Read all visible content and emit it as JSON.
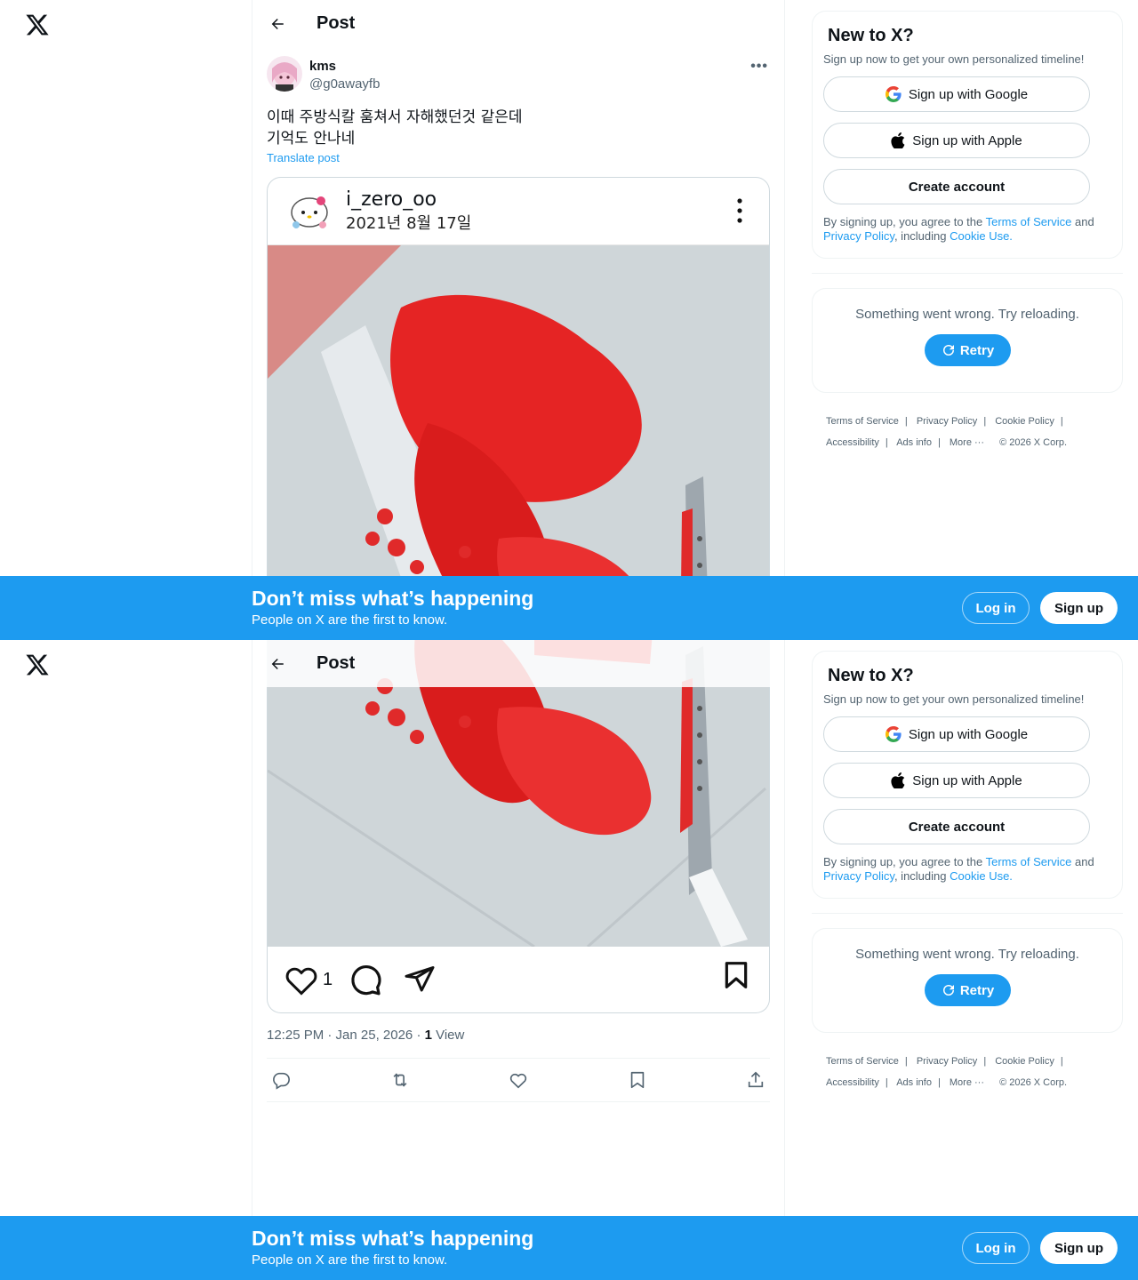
{
  "header": {
    "title": "Post"
  },
  "post": {
    "author_name": "kms",
    "author_handle": "@g0awayfb",
    "text": "이때 주방식칼 훔쳐서 자해했던것 같은데\n기억도 안나네",
    "translate": "Translate post",
    "timestamp": "12:25 PM · Jan 25, 2026 · ",
    "views_count": "1",
    "views_label": " View"
  },
  "embedded": {
    "username": "i_zero_oo",
    "date": "2021년 8월 17일",
    "like_count": "1"
  },
  "sidebar": {
    "title": "New to X?",
    "subtitle": "Sign up now to get your own personalized timeline!",
    "google_label": "Sign up with Google",
    "apple_label": "Sign up with Apple",
    "create_label": "Create account",
    "terms_prefix": "By signing up, you agree to the ",
    "terms_link": "Terms of Service",
    "terms_and": " and ",
    "privacy_link": "Privacy Policy",
    "terms_including": ", including ",
    "cookie_link": "Cookie Use.",
    "error_text": "Something went wrong. Try reloading.",
    "retry_label": "Retry"
  },
  "footer": {
    "tos": "Terms of Service",
    "privacy": "Privacy Policy",
    "cookie": "Cookie Policy",
    "accessibility": "Accessibility",
    "ads": "Ads info",
    "more": "More ···",
    "copyright": "© 2026 X Corp."
  },
  "banner": {
    "title": "Don’t miss what’s happening",
    "subtitle": "People on X are the first to know.",
    "login_label": "Log in",
    "signup_label": "Sign up"
  },
  "colors": {
    "accent": "#1d9bf0",
    "text": "#0f1419",
    "secondary": "#536471"
  }
}
